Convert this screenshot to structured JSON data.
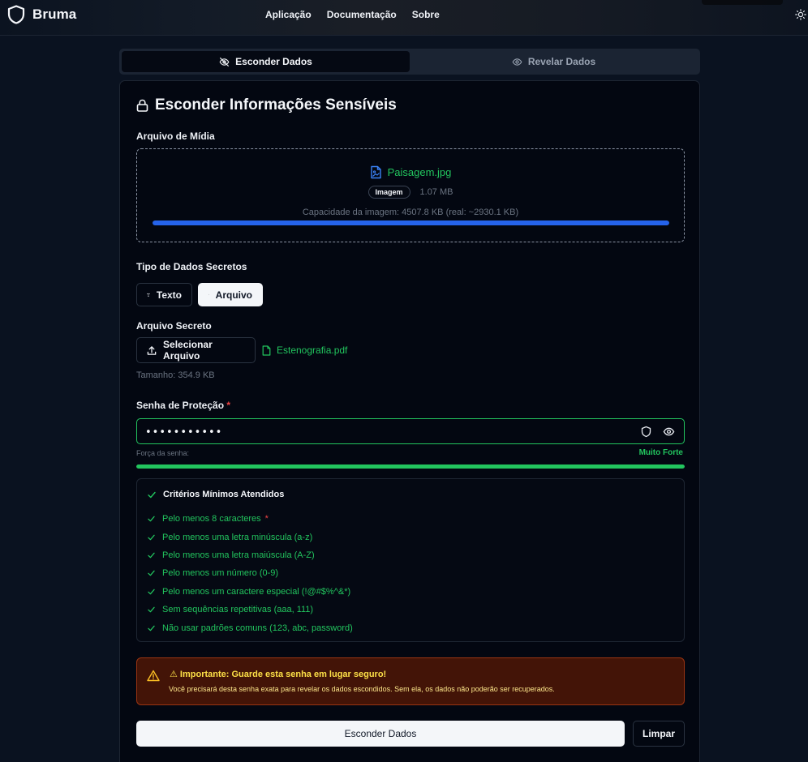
{
  "navbar": {
    "brand": "Bruma",
    "links": [
      "Aplicação",
      "Documentação",
      "Sobre"
    ]
  },
  "tabs": {
    "hide": "Esconder Dados",
    "reveal": "Revelar Dados"
  },
  "card": {
    "title": "Esconder Informações Sensíveis"
  },
  "media": {
    "label": "Arquivo de Mídia",
    "file_name": "Paisagem.jpg",
    "badge": "Imagem",
    "file_size": "1.07 MB",
    "capacity": "Capacidade da imagem: 4507.8 KB (real: ~2930.1 KB)",
    "capacity_fill": 1.0
  },
  "secret_type": {
    "label": "Tipo de Dados Secretos",
    "text_option": "Texto",
    "file_option": "Arquivo",
    "selected": "Arquivo"
  },
  "secret_file": {
    "label": "Arquivo Secreto",
    "select_button": "Selecionar Arquivo",
    "file_name": "Estenografia.pdf",
    "size": "Tamanho: 354.9 KB"
  },
  "password": {
    "label": "Senha de Proteção",
    "required_mark": "*",
    "value": "•••••••••••",
    "strength_label": "Força da senha:",
    "strength_value": "Muito Forte",
    "strength_fill": 1.0
  },
  "criteria": {
    "title": "Critérios Mínimos Atendidos",
    "items": [
      "Pelo menos 8 caracteres",
      "Pelo menos uma letra minúscula (a-z)",
      "Pelo menos uma letra maiúscula (A-Z)",
      "Pelo menos um número (0-9)",
      "Pelo menos um caractere especial (!@#$%^&*)",
      "Sem sequências repetitivas (aaa, 111)",
      "Não usar padrões comuns (123, abc, password)"
    ],
    "required_mark": "*"
  },
  "warning": {
    "title": "⚠ Importante: Guarde esta senha em lugar seguro!",
    "text": "Você precisará desta senha exata para revelar os dados escondidos. Sem ela, os dados não poderão ser recuperados."
  },
  "actions": {
    "submit": "Esconder Dados",
    "clear": "Limpar"
  },
  "colors": {
    "success": "#22c55e",
    "progress": "#2563eb",
    "warning_bg": "#431407",
    "warning_border": "#9a3412",
    "required": "#ef4444"
  }
}
